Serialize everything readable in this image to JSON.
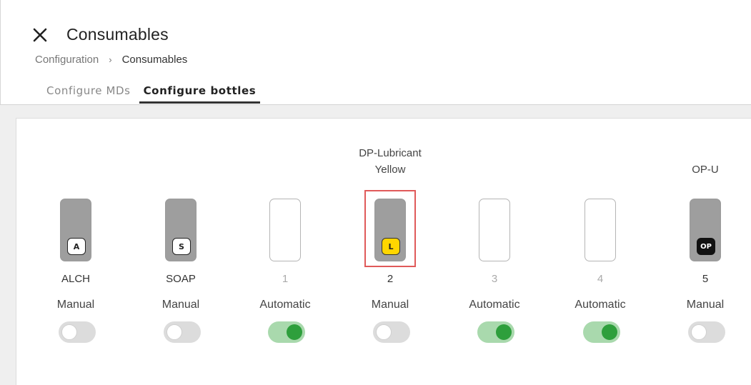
{
  "header": {
    "title": "Consumables",
    "close_icon": "close-icon",
    "breadcrumb": {
      "parent": "Configuration",
      "separator": "›",
      "current": "Consumables"
    },
    "tabs": [
      {
        "label": "Configure MDs",
        "active": false
      },
      {
        "label": "Configure bottles",
        "active": true
      }
    ]
  },
  "bottles": [
    {
      "name": "",
      "badge": "A",
      "badge_style": "white",
      "filled": true,
      "position": "ALCH",
      "position_muted": false,
      "mode": "Manual",
      "toggle_on": false
    },
    {
      "name": "",
      "badge": "S",
      "badge_style": "white",
      "filled": true,
      "position": "SOAP",
      "position_muted": false,
      "mode": "Manual",
      "toggle_on": false
    },
    {
      "name": "",
      "badge": "",
      "badge_style": "",
      "filled": false,
      "position": "1",
      "position_muted": true,
      "mode": "Automatic",
      "toggle_on": true
    },
    {
      "name": "DP-Lubricant\nYellow",
      "badge": "L",
      "badge_style": "yellow",
      "filled": true,
      "position": "2",
      "position_muted": false,
      "mode": "Manual",
      "toggle_on": false,
      "highlighted": true
    },
    {
      "name": "",
      "badge": "",
      "badge_style": "",
      "filled": false,
      "position": "3",
      "position_muted": true,
      "mode": "Automatic",
      "toggle_on": true
    },
    {
      "name": "",
      "badge": "",
      "badge_style": "",
      "filled": false,
      "position": "4",
      "position_muted": true,
      "mode": "Automatic",
      "toggle_on": true
    },
    {
      "name": "OP-U",
      "badge": "OP",
      "badge_style": "black",
      "filled": true,
      "position": "5",
      "position_muted": false,
      "mode": "Manual",
      "toggle_on": false
    }
  ],
  "colors": {
    "highlight": "#e05a5a",
    "toggle_on": "#2e9f3c",
    "badge_yellow": "#ffd600"
  }
}
